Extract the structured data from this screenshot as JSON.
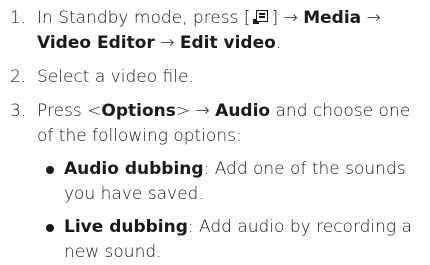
{
  "steps": [
    {
      "number": "1.",
      "parts": {
        "t1": "In Standby mode, press [",
        "icon": "menu-key-icon",
        "t2": "] → ",
        "b1": "Media",
        "t3": " → ",
        "b2": "Video Editor",
        "t4": " → ",
        "b3": "Edit video",
        "t5": "."
      }
    },
    {
      "number": "2.",
      "text": "Select a video file."
    },
    {
      "number": "3.",
      "parts": {
        "t1": "Press <",
        "b1": "Options",
        "t2": "> → ",
        "b2": "Audio",
        "t3": " and choose one of the following options:"
      },
      "options": [
        {
          "name": "Audio dubbing",
          "description": ": Add one of the sounds you have saved."
        },
        {
          "name": "Live dubbing",
          "description": ": Add audio by recording a new sound."
        }
      ]
    }
  ]
}
